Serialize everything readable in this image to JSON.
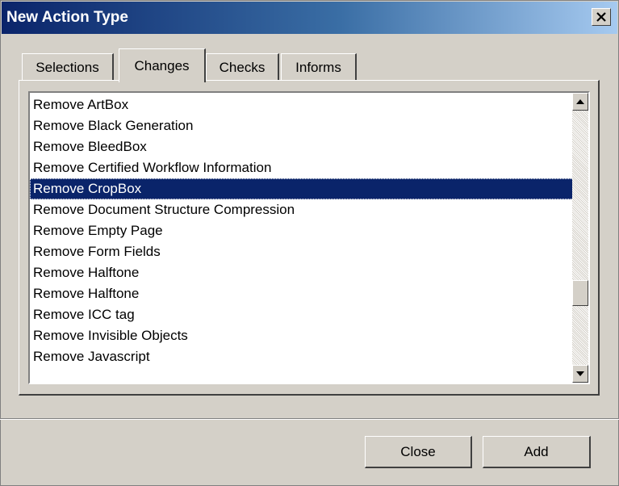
{
  "window": {
    "title": "New Action Type"
  },
  "tabs": [
    {
      "label": "Selections",
      "active": false
    },
    {
      "label": "Changes",
      "active": true
    },
    {
      "label": "Checks",
      "active": false
    },
    {
      "label": "Informs",
      "active": false
    }
  ],
  "list": {
    "items": [
      "Remove ArtBox",
      "Remove Black Generation",
      "Remove BleedBox",
      "Remove Certified Workflow Information",
      "Remove CropBox",
      "Remove Document Structure Compression",
      "Remove Empty Page",
      "Remove Form Fields",
      "Remove Halftone",
      "Remove Halftone",
      "Remove ICC tag",
      "Remove Invisible Objects",
      "Remove Javascript"
    ],
    "selected_index": 4
  },
  "buttons": {
    "close_label": "Close",
    "add_label": "Add"
  },
  "icons": {
    "close": "close-icon",
    "scroll_up": "arrow-up-icon",
    "scroll_down": "arrow-down-icon"
  },
  "colors": {
    "title_bar": "#0a246a",
    "selection": "#0a246a",
    "face": "#d4d0c8"
  }
}
